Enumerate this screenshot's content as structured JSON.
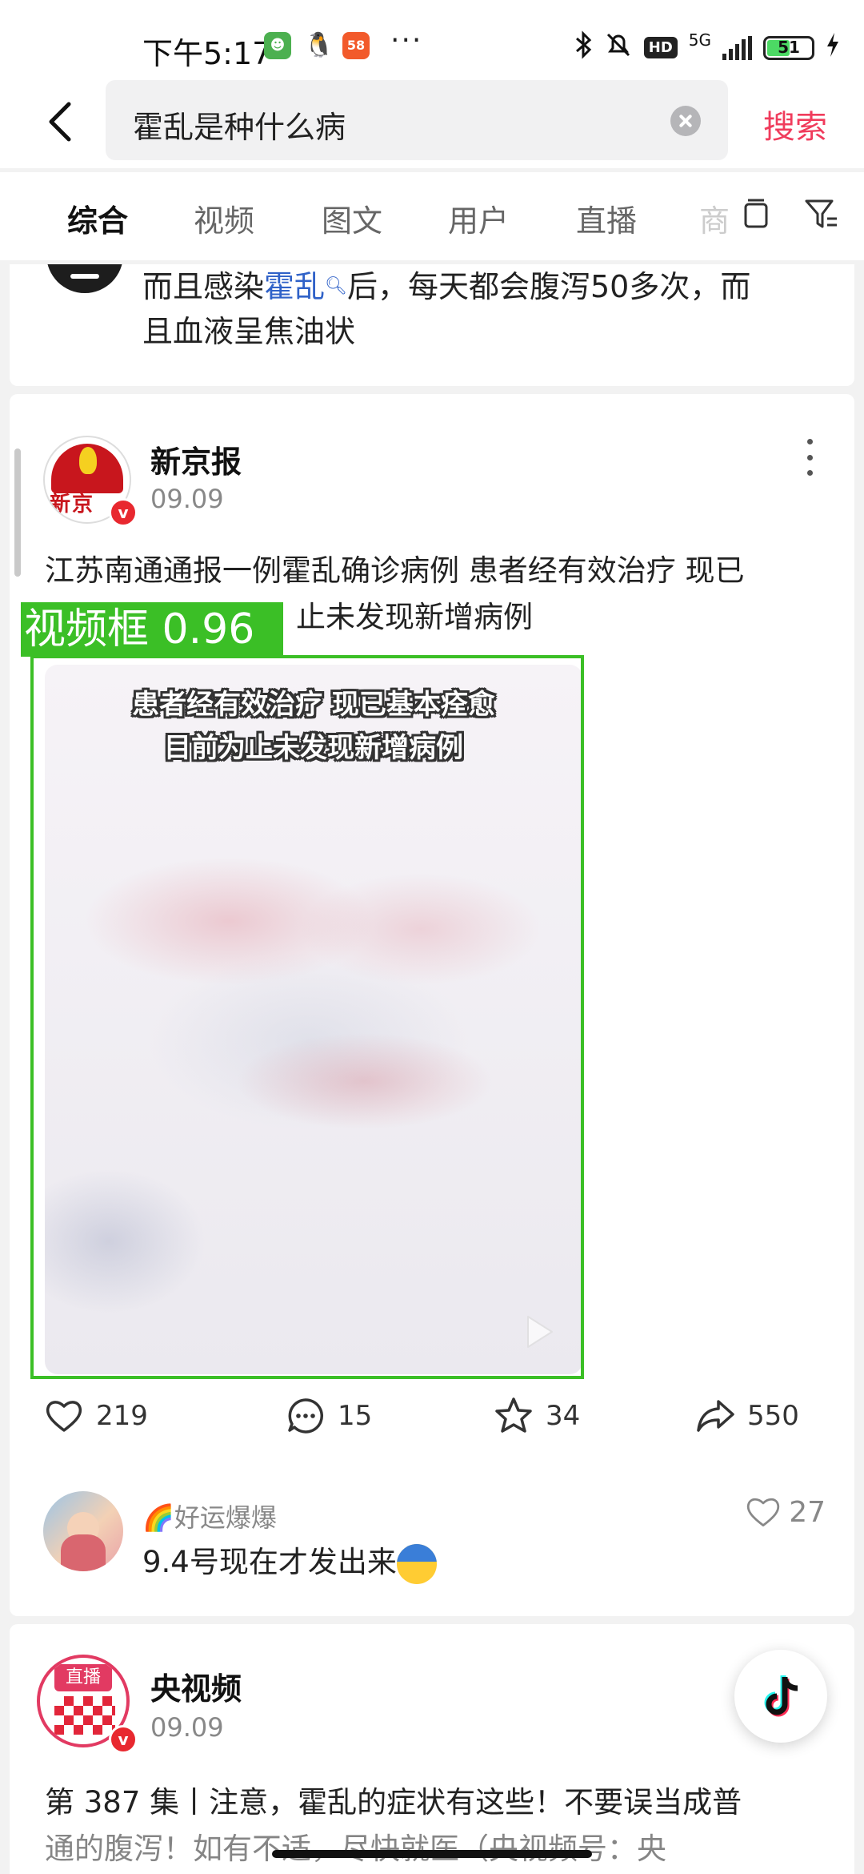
{
  "status_bar": {
    "time": "下午5:17",
    "network": "5G",
    "battery": "51",
    "hd_label": "HD"
  },
  "search": {
    "query": "霍乱是种什么病",
    "action_label": "搜索"
  },
  "tabs": [
    {
      "label": "综合",
      "active": true
    },
    {
      "label": "视频",
      "active": false
    },
    {
      "label": "图文",
      "active": false
    },
    {
      "label": "用户",
      "active": false
    },
    {
      "label": "直播",
      "active": false
    },
    {
      "label": "商",
      "active": false
    }
  ],
  "prev_post": {
    "text_before": "而且感染",
    "highlight": "霍乱",
    "text_after": "后，每天都会腹泻50多次，而",
    "line2": "且血液呈焦油状"
  },
  "post": {
    "author": "新京报",
    "avatar_text": "新京",
    "date": "09.09",
    "text_line1": "江苏南通通报一例霍乱确诊病例 患者经有效治疗 现已",
    "text_line2": "止未发现新增病例",
    "detection_label": "视频框 0.96",
    "video_caption_1": "患者经有效治疗 现已基本痊愈",
    "video_caption_2": "目前为止未发现新增病例",
    "likes": "219",
    "comments": "15",
    "favorites": "34",
    "shares": "550",
    "top_comment": {
      "user": "🌈好运爆爆",
      "text": "9.4号现在才发出来",
      "likes": "27"
    }
  },
  "next_post": {
    "author": "央视频",
    "live_badge": "直播",
    "date": "09.09",
    "text_line1": "第 387 集丨注意，霍乱的症状有这些！不要误当成普",
    "text_line2": "通的腹泻！如有不适，尽快就医（央视频号：央"
  },
  "colors": {
    "accent": "#f03c5c",
    "highlight": "#3062c8",
    "detection": "#3bbf26"
  },
  "icons": [
    "back-icon",
    "clear-icon",
    "copy-icon",
    "filter-icon",
    "more-icon",
    "heart-icon",
    "comment-icon",
    "star-icon",
    "share-icon",
    "play-icon",
    "tiktok-icon"
  ]
}
